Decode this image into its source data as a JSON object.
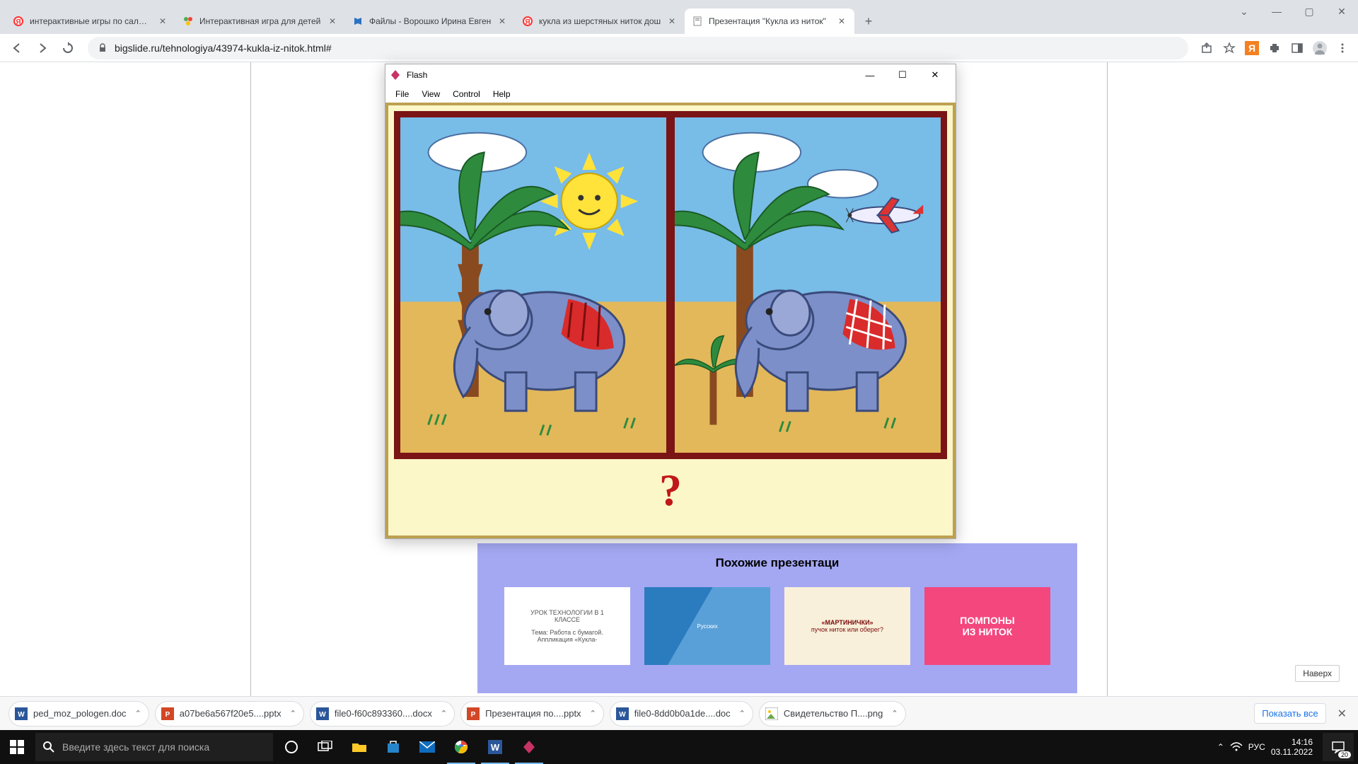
{
  "tabs": [
    {
      "title": "интерактивные игры по салмин",
      "favicon": "yandex"
    },
    {
      "title": "Интерактивная игра для детей",
      "favicon": "green"
    },
    {
      "title": "Файлы - Ворошко Ирина Евген",
      "favicon": "blue"
    },
    {
      "title": "кукла из шерстяных ниток дош",
      "favicon": "yandex"
    },
    {
      "title": "Презентация \"Кукла из ниток\"",
      "favicon": "doc",
      "active": true
    }
  ],
  "url": "bigslide.ru/tehnologiya/43974-kukla-iz-nitok.html#",
  "flash": {
    "title": "Flash",
    "menu": [
      "File",
      "View",
      "Control",
      "Help"
    ],
    "question_mark": "?"
  },
  "page_content": {
    "similar_title": "Похожие презентаци",
    "thumbs": [
      {
        "line1": "УРОК ТЕХНОЛОГИИ В 1",
        "line2": "КЛАССЕ",
        "line3": "Тема: Работа с бумагой.",
        "line4": "Аппликация «Кукла-"
      },
      {
        "line1": "Русских"
      },
      {
        "line1": "«МАРТИНИЧКИ»",
        "line2": "пучок ниток или оберег?"
      },
      {
        "line1": "ПОМПОНЫ",
        "line2": "ИЗ НИТОК"
      }
    ],
    "top_button": "Наверх"
  },
  "downloads": {
    "items": [
      {
        "name": "ped_moz_pologen.doc",
        "type": "word"
      },
      {
        "name": "a07be6a567f20e5....pptx",
        "type": "ppt"
      },
      {
        "name": "file0-f60c893360....docx",
        "type": "word"
      },
      {
        "name": "Презентация по....pptx",
        "type": "ppt"
      },
      {
        "name": "file0-8dd0b0a1de....doc",
        "type": "word"
      },
      {
        "name": "Свидетельство П....png",
        "type": "img"
      }
    ],
    "show_all": "Показать все"
  },
  "taskbar": {
    "search_placeholder": "Введите здесь текст для поиска",
    "lang": "РУС",
    "time": "14:16",
    "date": "03.11.2022",
    "notif_count": "20"
  }
}
